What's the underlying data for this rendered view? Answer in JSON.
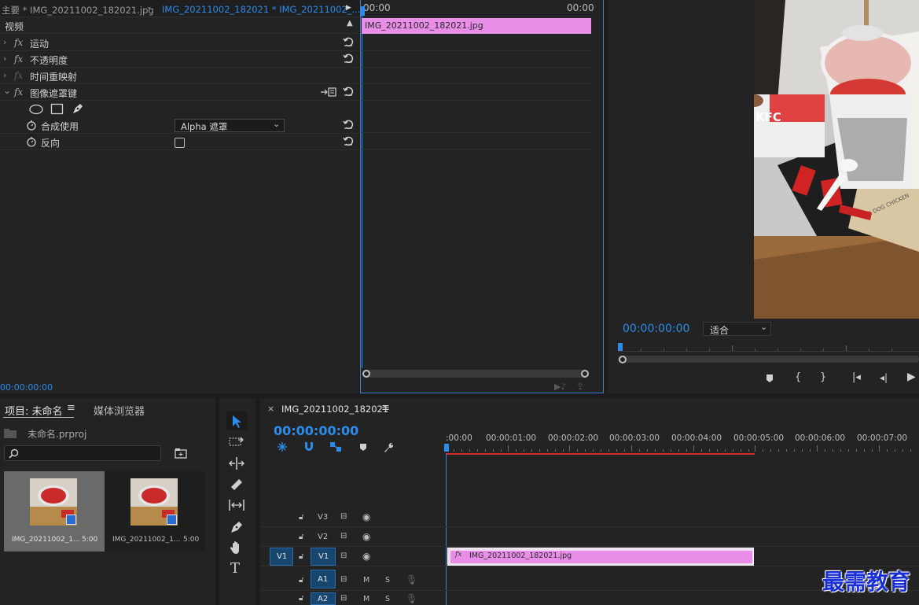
{
  "effect_controls": {
    "tab_main": "主要 * IMG_20211002_182021.jpg",
    "tab_clip": "IMG_20211002_182021 * IMG_20211002_...",
    "section_label": "视频",
    "rows": [
      {
        "label": "运动"
      },
      {
        "label": "不透明度"
      },
      {
        "label": "时间重映射"
      },
      {
        "label": "图像遮罩键"
      }
    ],
    "composite_label": "合成使用",
    "composite_value": "Alpha 遮罩",
    "invert_label": "反向",
    "timecode": "00:00:00:00",
    "mini_ruler_start": "00:00",
    "mini_ruler_end": "00:00",
    "clip_name": "IMG_20211002_182021.jpg"
  },
  "program_monitor": {
    "timecode": "00:00:00:00",
    "fit_label": "适合"
  },
  "project_panel": {
    "tab_project": "项目: 未命名",
    "tab_media": "媒体浏览器",
    "file_name": "未命名.prproj",
    "items": [
      {
        "name": "IMG_20211002_1...",
        "duration": "5:00"
      },
      {
        "name": "IMG_20211002_1...",
        "duration": "5:00"
      }
    ]
  },
  "timeline": {
    "tab_label": "IMG_20211002_182021",
    "close_label": "×",
    "timecode": "00:00:00:00",
    "ruler_labels": [
      ":00:00",
      "00:00:01:00",
      "00:00:02:00",
      "00:00:03:00",
      "00:00:04:00",
      "00:00:05:00",
      "00:00:06:00",
      "00:00:07:00"
    ],
    "tracks": {
      "v3": "V3",
      "v2": "V2",
      "v1_src": "V1",
      "v1": "V1",
      "a1": "A1",
      "a2": "A2",
      "m": "M",
      "s": "S"
    },
    "clip_name": "IMG_20211002_182021.jpg"
  },
  "watermark": "最需教育",
  "colors": {
    "accent_blue": "#2d8ceb",
    "clip_pink": "#e88de8",
    "panel_bg": "#232323",
    "render_bar_red": "#d62b2b"
  }
}
